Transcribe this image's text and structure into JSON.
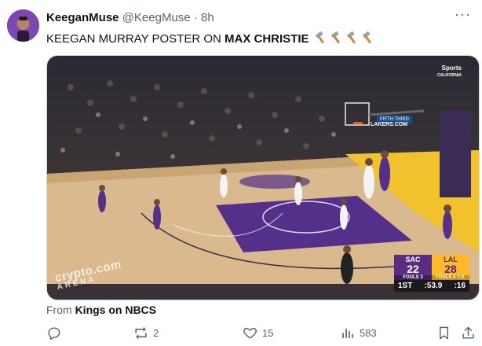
{
  "tweet": {
    "display_name": "KeeganMuse",
    "handle": "@KeegMuse",
    "separator": "·",
    "time": "8h",
    "text_prefix": "KEEGAN MURRAY POSTER ON ",
    "text_bold": "MAX CHRISTIE",
    "emoji": [
      "hammer",
      "hammer",
      "hammer",
      "hammer"
    ],
    "more_label": "···"
  },
  "video": {
    "network_logo": "Sports",
    "network_sub": "CALIFORNIA",
    "court_text": "LAKERS.COM",
    "ad_board": "FIFTH THIRD",
    "watermark_main": "crypto.com",
    "watermark_sub": "ARENA",
    "scoreboard": {
      "away_abbr": "SAC",
      "away_score": "22",
      "away_fouls": "FOULS 3",
      "home_abbr": "LAL",
      "home_score": "28",
      "home_fouls": "FOULS 4 T.O.",
      "period": "1ST",
      "clock": ":53.9",
      "shot_clock": ":16",
      "colors": {
        "away": "#5a2d81",
        "home": "#fdb927"
      }
    }
  },
  "attribution": {
    "prefix": "From ",
    "source": "Kings on NBCS"
  },
  "actions": {
    "reply": {
      "icon": "reply-icon",
      "count": ""
    },
    "retweet": {
      "icon": "retweet-icon",
      "count": "2"
    },
    "like": {
      "icon": "heart-icon",
      "count": "15"
    },
    "views": {
      "icon": "views-icon",
      "count": "583"
    },
    "bookmark": {
      "icon": "bookmark-icon",
      "count": ""
    },
    "share": {
      "icon": "share-icon",
      "count": ""
    }
  }
}
